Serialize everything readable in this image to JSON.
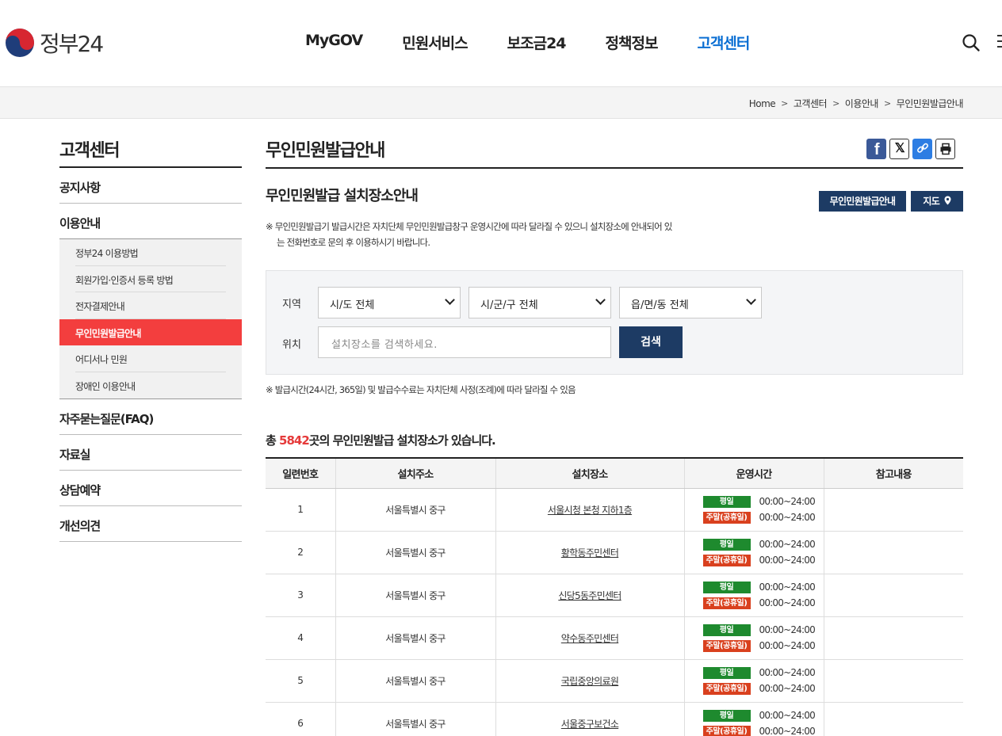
{
  "header": {
    "logo_text": "정부24",
    "nav": [
      "MyGOV",
      "민원서비스",
      "보조금24",
      "정책정보",
      "고객센터"
    ],
    "active_nav": "고객센터"
  },
  "breadcrumb": [
    "Home",
    "고객센터",
    "이용안내",
    "무인민원발급안내"
  ],
  "sidebar": {
    "title": "고객센터",
    "items": [
      {
        "label": "공지사항"
      },
      {
        "label": "이용안내",
        "children": [
          "정부24 이용방법",
          "회원가입·인증서 등록 방법",
          "전자결제안내",
          "무인민원발급안내",
          "어디서나 민원",
          "장애인 이용안내"
        ]
      },
      {
        "label": "자주묻는질문(FAQ)"
      },
      {
        "label": "자료실"
      },
      {
        "label": "상담예약"
      },
      {
        "label": "개선의견"
      }
    ],
    "active_child": "무인민원발급안내"
  },
  "page": {
    "title": "무인민원발급안내",
    "section_title": "무인민원발급 설치장소안내",
    "btn_kiosk": "무인민원발급안내",
    "btn_map": "지도",
    "notice_line1": "※ 무인민원발급기 발급시간은 자치단체 무인민원발급창구 운영시간에 따라 달라질 수 있으니 설치장소에 안내되어 있",
    "notice_line2": "는 전화번호로 문의 후 이용하시기 바랍니다.",
    "notice2": "※ 발급시간(24시간, 365일) 및 발급수수료는 자치단체 사정(조례)에 따라 달라질 수 있음"
  },
  "search": {
    "region_label": "지역",
    "location_label": "위치",
    "sido": "시/도 전체",
    "sigungu": "시/군/구 전체",
    "eupmyeondong": "읍/면/동 전체",
    "placeholder": "설치장소를 검색하세요.",
    "button": "검색"
  },
  "summary": {
    "prefix": "총 ",
    "count": "5842",
    "suffix": "곳의 무인민원발급 설치장소가 있습니다."
  },
  "table": {
    "headers": [
      "일련번호",
      "설치주소",
      "설치장소",
      "운영시간",
      "참고내용"
    ],
    "weekday_tag": "평일",
    "weekend_tag": "주말(공휴일)",
    "rows": [
      {
        "no": "1",
        "addr": "서울특별시 중구",
        "place": "서울시청 본청 지하1층",
        "wk": "00:00~24:00",
        "we": "00:00~24:00",
        "note": ""
      },
      {
        "no": "2",
        "addr": "서울특별시 중구",
        "place": "황학동주민센터",
        "wk": "00:00~24:00",
        "we": "00:00~24:00",
        "note": ""
      },
      {
        "no": "3",
        "addr": "서울특별시 중구",
        "place": "신당5동주민센터",
        "wk": "00:00~24:00",
        "we": "00:00~24:00",
        "note": ""
      },
      {
        "no": "4",
        "addr": "서울특별시 중구",
        "place": "약수동주민센터",
        "wk": "00:00~24:00",
        "we": "00:00~24:00",
        "note": ""
      },
      {
        "no": "5",
        "addr": "서울특별시 중구",
        "place": "국립중앙의료원",
        "wk": "00:00~24:00",
        "we": "00:00~24:00",
        "note": ""
      },
      {
        "no": "6",
        "addr": "서울특별시 중구",
        "place": "서울중구보건소",
        "wk": "00:00~24:00",
        "we": "00:00~24:00",
        "note": ""
      }
    ]
  }
}
